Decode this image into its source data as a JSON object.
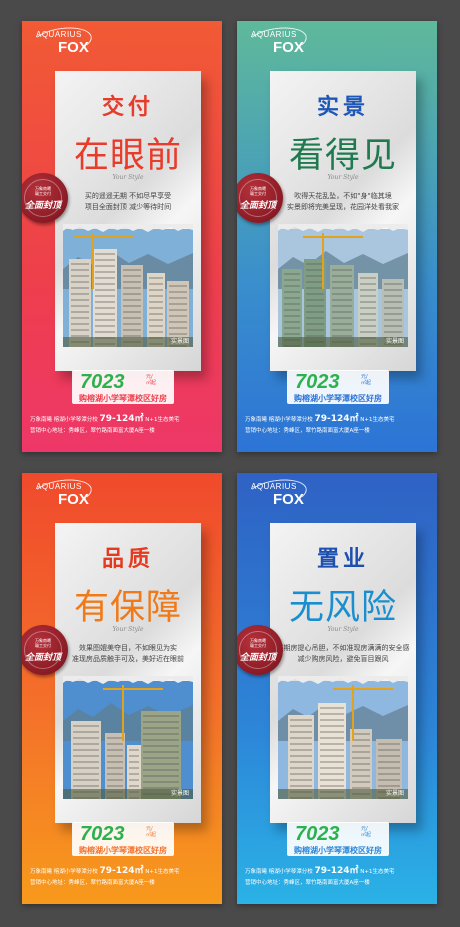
{
  "posters": [
    {
      "brand_line1": "AQUARIUS",
      "brand_line2": "FOX",
      "title1": "交付",
      "title2": "在眼前",
      "script": "Your Style",
      "desc_line1": "买的遥遥无期 不如尽早享受",
      "desc_line2": "项目全面封顶 减少等待时间",
      "seal_sub_line1": "万象南曦",
      "seal_sub_line2": "赣工交付",
      "seal_main": "全面封顶",
      "caption": "实景图",
      "price": "7023",
      "price_unit_line1": "元/",
      "price_unit_line2": "㎡起",
      "school": "购榕湖小学琴潭校区好房",
      "info_line1_a": "万象南曦 榕湖小学琴潭分校",
      "info_line1_big": "79-124㎡",
      "info_line1_b": "N+1生态美宅",
      "info_line2": "营销中心地址：秀峰区，翠竹路南面富大厦A座一楼",
      "title_color": "#e83c2b",
      "title2_color": "#e83c2b",
      "accent": "#ee3f4c"
    },
    {
      "brand_line1": "AQUARIUS",
      "brand_line2": "FOX",
      "title1": "实景",
      "title2": "看得见",
      "script": "Your Style",
      "desc_line1": "吹得天花乱坠，不如\"身\"临其境",
      "desc_line2": "实景即将完美呈现，花园洋处看我家",
      "seal_sub_line1": "万象南曦",
      "seal_sub_line2": "赣工交付",
      "seal_main": "全面封顶",
      "caption": "实景图",
      "price": "7023",
      "price_unit_line1": "元/",
      "price_unit_line2": "㎡起",
      "school": "购榕湖小学琴潭校区好房",
      "info_line1_a": "万象南曦 榕湖小学琴潭分校",
      "info_line1_big": "79-124㎡",
      "info_line1_b": "N+1生态美宅",
      "info_line2": "营销中心地址：秀峰区，翠竹路南面富大厦A座一楼",
      "title_color": "#1f57b7",
      "title2_color": "#1f7a4f",
      "accent": "#2c74d6"
    },
    {
      "brand_line1": "AQUARIUS",
      "brand_line2": "FOX",
      "title1": "品质",
      "title2": "有保障",
      "script": "Your Style",
      "desc_line1": "效果图媲美夺目，不如眼见为实",
      "desc_line2": "准现房品质触手可及，美好近在眼前",
      "seal_sub_line1": "万象南曦",
      "seal_sub_line2": "赣工交付",
      "seal_main": "全面封顶",
      "caption": "实景图",
      "price": "7023",
      "price_unit_line1": "元/",
      "price_unit_line2": "㎡起",
      "school": "购榕湖小学琴潭校区好房",
      "info_line1_a": "万象南曦 榕湖小学琴潭分校",
      "info_line1_big": "79-124㎡",
      "info_line1_b": "N+1生态美宅",
      "info_line2": "营销中心地址：秀峰区，翠竹路南面富大厦A座一楼",
      "title_color": "#e63a20",
      "title2_color": "#f07a1a",
      "accent": "#f4712a"
    },
    {
      "brand_line1": "AQUARIUS",
      "brand_line2": "FOX",
      "title1": "置业",
      "title2": "无风险",
      "script": "Your Style",
      "desc_line1": "买期房提心吊胆，不如准现房满满的安全感",
      "desc_line2": "减少购房风险，避免盲目跟风",
      "seal_sub_line1": "万象南曦",
      "seal_sub_line2": "赣工交付",
      "seal_main": "全面封顶",
      "caption": "实景图",
      "price": "7023",
      "price_unit_line1": "元/",
      "price_unit_line2": "㎡起",
      "school": "购榕湖小学琴潭校区好房",
      "info_line1_a": "万象南曦 榕湖小学琴潭分校",
      "info_line1_big": "79-124㎡",
      "info_line1_b": "N+1生态美宅",
      "info_line2": "营销中心地址：秀峰区，翠竹路南面富大厦A座一楼",
      "title_color": "#1d4fb0",
      "title2_color": "#1a8fd0",
      "accent": "#2d86d8"
    }
  ]
}
